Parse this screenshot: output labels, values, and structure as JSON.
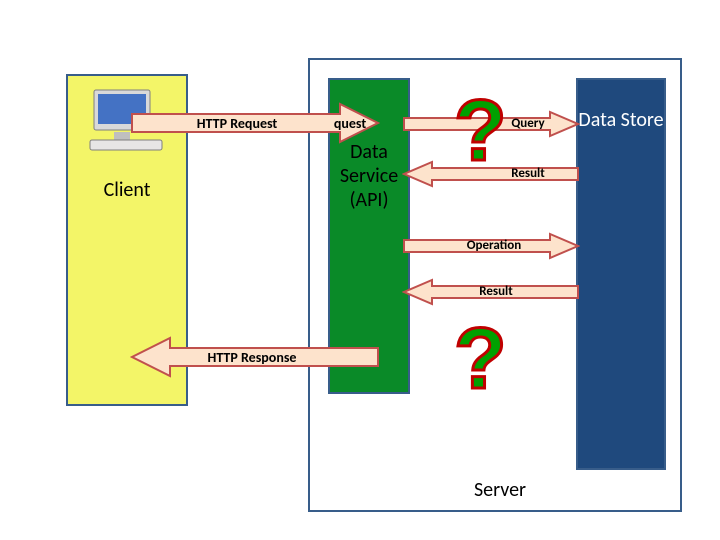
{
  "client": {
    "label": "Client"
  },
  "server": {
    "label": "Server"
  },
  "data_service": {
    "label": "Data Service (API)"
  },
  "data_store": {
    "label": "Data Store"
  },
  "arrows": {
    "http_request": "HTTP Request",
    "http_response": "HTTP Response",
    "query": "Query",
    "result1": "Result",
    "operation": "Operation",
    "result2": "Result",
    "right_request_fragment": "quest"
  },
  "qmark1": "?",
  "qmark2": "?"
}
